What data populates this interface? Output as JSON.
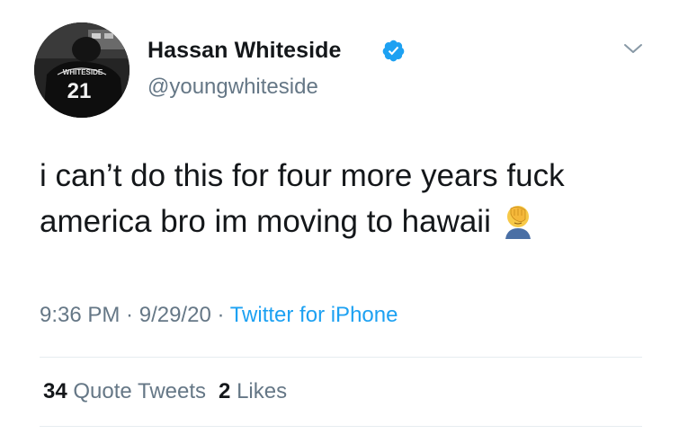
{
  "user": {
    "display_name": "Hassan Whiteside",
    "handle": "@youngwhiteside",
    "verified": true,
    "avatar_jersey_name": "WHITESIDE",
    "avatar_jersey_number": "21"
  },
  "tweet": {
    "line1": "i can’t do this for four more years fuck",
    "line2": "america bro im moving to hawaii",
    "emoji": "face-palm-emoji"
  },
  "meta": {
    "time": "9:36 PM",
    "sep1": " · ",
    "date": "9/29/20",
    "sep2": " · ",
    "source": "Twitter for iPhone"
  },
  "stats": {
    "quote_count": "34",
    "quote_label": "Quote Tweets",
    "like_count": "2",
    "like_label": "Likes"
  },
  "colors": {
    "text": "#14171a",
    "secondary": "#657786",
    "accent": "#1da1f2",
    "divider": "#e6ecf0"
  }
}
